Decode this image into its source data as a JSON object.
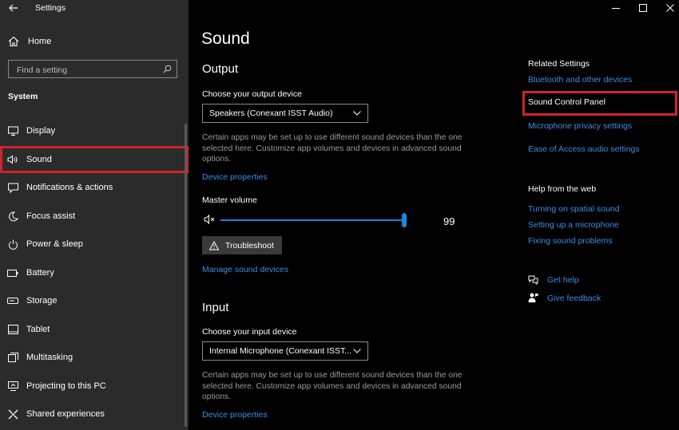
{
  "window": {
    "title": "Settings"
  },
  "sidebar": {
    "home_label": "Home",
    "search_placeholder": "Find a setting",
    "section_label": "System",
    "items": [
      {
        "label": "Display",
        "icon": "display-icon"
      },
      {
        "label": "Sound",
        "icon": "speaker-icon",
        "active": true
      },
      {
        "label": "Notifications & actions",
        "icon": "notifications-icon"
      },
      {
        "label": "Focus assist",
        "icon": "moon-icon"
      },
      {
        "label": "Power & sleep",
        "icon": "power-icon"
      },
      {
        "label": "Battery",
        "icon": "battery-icon"
      },
      {
        "label": "Storage",
        "icon": "storage-icon"
      },
      {
        "label": "Tablet",
        "icon": "tablet-icon"
      },
      {
        "label": "Multitasking",
        "icon": "multitasking-icon"
      },
      {
        "label": "Projecting to this PC",
        "icon": "projecting-icon"
      },
      {
        "label": "Shared experiences",
        "icon": "shared-icon"
      }
    ]
  },
  "main": {
    "page_title": "Sound",
    "output": {
      "title": "Output",
      "choose_label": "Choose your output device",
      "device": "Speakers (Conexant ISST Audio)",
      "description": "Certain apps may be set up to use different sound devices than the one selected here. Customize app volumes and devices in advanced sound options.",
      "device_properties": "Device properties",
      "master_volume_label": "Master volume",
      "volume": 99,
      "troubleshoot_label": "Troubleshoot",
      "manage_devices": "Manage sound devices"
    },
    "input": {
      "title": "Input",
      "choose_label": "Choose your input device",
      "device": "Internal Microphone (Conexant ISST...",
      "description": "Certain apps may be set up to use different sound devices than the one selected here. Customize app volumes and devices in advanced sound options.",
      "device_properties": "Device properties"
    }
  },
  "related": {
    "title": "Related Settings",
    "links": [
      "Bluetooth and other devices",
      "Sound Control Panel",
      "Microphone privacy settings",
      "Ease of Access audio settings"
    ],
    "help_title": "Help from the web",
    "help_links": [
      "Turning on spatial sound",
      "Setting up a microphone",
      "Fixing sound problems"
    ],
    "get_help": "Get help",
    "give_feedback": "Give feedback"
  },
  "colors": {
    "accent": "#3a8ee6",
    "highlight": "#d0232d",
    "sidebar_bg": "#2b2b2b"
  }
}
